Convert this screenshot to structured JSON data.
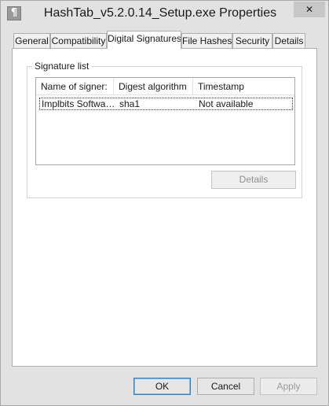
{
  "window": {
    "title": "HashTab_v5.2.0.14_Setup.exe Properties",
    "app_icon": "file-properties-icon",
    "app_icon_glyph": "¶",
    "close_glyph": "✕"
  },
  "tabs": [
    {
      "label": "General",
      "active": false
    },
    {
      "label": "Compatibility",
      "active": false
    },
    {
      "label": "Digital Signatures",
      "active": true
    },
    {
      "label": "File Hashes",
      "active": false
    },
    {
      "label": "Security",
      "active": false
    },
    {
      "label": "Details",
      "active": false
    }
  ],
  "signatures": {
    "group_label": "Signature list",
    "columns": [
      "Name of signer:",
      "Digest algorithm",
      "Timestamp"
    ],
    "rows": [
      {
        "signer": "Implbits Software,...",
        "digest": "sha1",
        "timestamp": "Not available"
      }
    ],
    "details_label": "Details"
  },
  "footer": {
    "ok_label": "OK",
    "cancel_label": "Cancel",
    "apply_label": "Apply"
  },
  "colors": {
    "chrome": "#e2e2e2",
    "panel": "#ffffff",
    "focus_border": "#3c7fb1"
  }
}
